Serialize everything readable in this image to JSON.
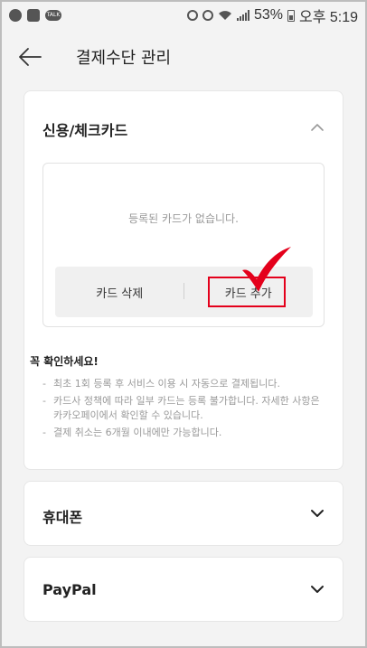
{
  "status_bar": {
    "battery_text": "53%",
    "time": "오후 5:19",
    "left_icons": [
      "kakao-icon",
      "gallery-icon",
      "talk-icon"
    ],
    "right_icons": [
      "recycle-icon",
      "alarm-icon",
      "wifi-icon",
      "signal-icon",
      "battery-icon"
    ]
  },
  "header": {
    "title": "결제수단 관리",
    "back_icon": "back-arrow-icon"
  },
  "credit_section": {
    "title": "신용/체크카드",
    "empty_text": "등록된 카드가 없습니다.",
    "delete_label": "카드 삭제",
    "add_label": "카드 추가",
    "notice_title": "꼭 확인하세요!",
    "notes": [
      "최초 1회 등록 후 서비스 이용 시 자동으로 결제됩니다.",
      "카드사 정책에 따라 일부 카드는 등록 불가합니다. 자세한 사항은 카카오페이에서 확인할 수 있습니다.",
      "결제 취소는 6개월 이내에만 가능합니다."
    ]
  },
  "phone_section": {
    "title": "휴대폰"
  },
  "paypal_section": {
    "title": "PayPal"
  },
  "colors": {
    "highlight": "#e4001b",
    "background": "#f3f3f3",
    "muted": "#9a9a9a"
  }
}
